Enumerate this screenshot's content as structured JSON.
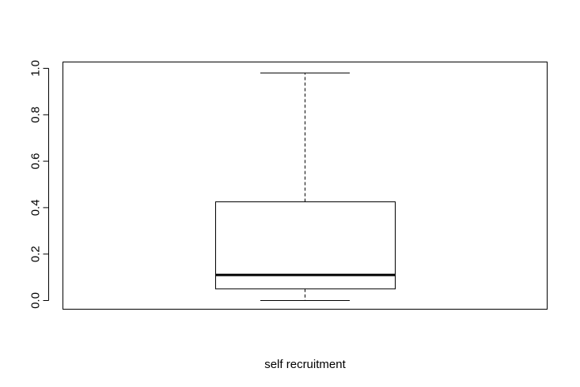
{
  "chart_data": {
    "type": "box",
    "title": "",
    "xlabel": "self recruitment",
    "ylabel": "",
    "ylim": [
      -0.04,
      1.03
    ],
    "yticks": [
      0.0,
      0.2,
      0.4,
      0.6,
      0.8,
      1.0
    ],
    "ytick_labels": [
      "0.0",
      "0.2",
      "0.4",
      "0.6",
      "0.8",
      "1.0"
    ],
    "grid": false,
    "box": {
      "whisker_low": 0.0,
      "q1": 0.05,
      "median": 0.11,
      "q3": 0.425,
      "whisker_high": 0.98
    },
    "colors": {
      "stroke": "#000000",
      "background": "#ffffff"
    }
  }
}
